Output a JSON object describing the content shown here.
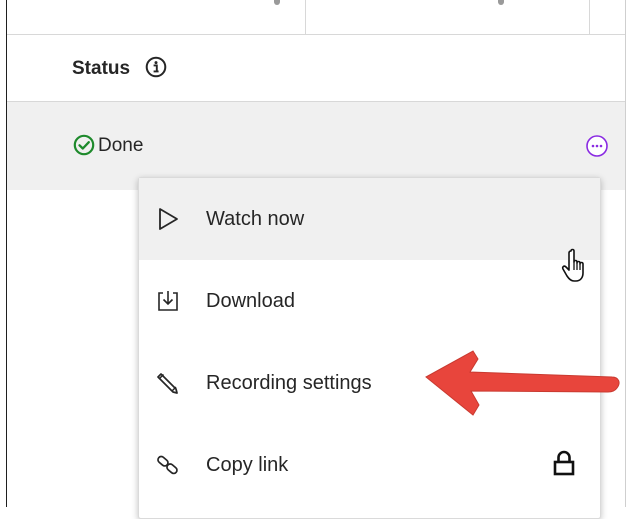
{
  "table": {
    "status_header": "Status",
    "row": {
      "status": "Done"
    }
  },
  "menu": {
    "items": [
      {
        "label": "Watch now",
        "icon": "play-outline-icon"
      },
      {
        "label": "Download",
        "icon": "download-icon"
      },
      {
        "label": "Recording settings",
        "icon": "pencil-icon"
      },
      {
        "label": "Copy link",
        "icon": "link-icon",
        "trailing_icon": "lock-icon"
      }
    ]
  },
  "colors": {
    "done_green": "#1e8a2c",
    "more_purple": "#8a2be2",
    "row_hover": "#f0f0f0",
    "annotation_arrow": "#e8453c"
  }
}
